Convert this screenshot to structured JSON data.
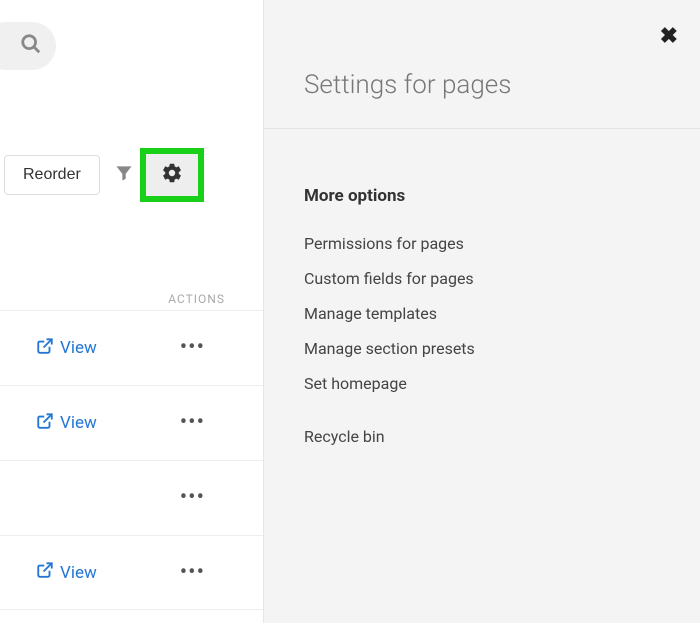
{
  "toolbar": {
    "reorder_label": "Reorder"
  },
  "list": {
    "actions_header": "ACTIONS",
    "view_label": "View",
    "rows": [
      {
        "has_view": true
      },
      {
        "has_view": true
      },
      {
        "has_view": false
      },
      {
        "has_view": true
      }
    ]
  },
  "panel": {
    "title": "Settings for pages",
    "more_options_label": "More options",
    "options": [
      "Permissions for pages",
      "Custom fields for pages",
      "Manage templates",
      "Manage section presets",
      "Set homepage"
    ],
    "recycle_bin": "Recycle bin"
  }
}
